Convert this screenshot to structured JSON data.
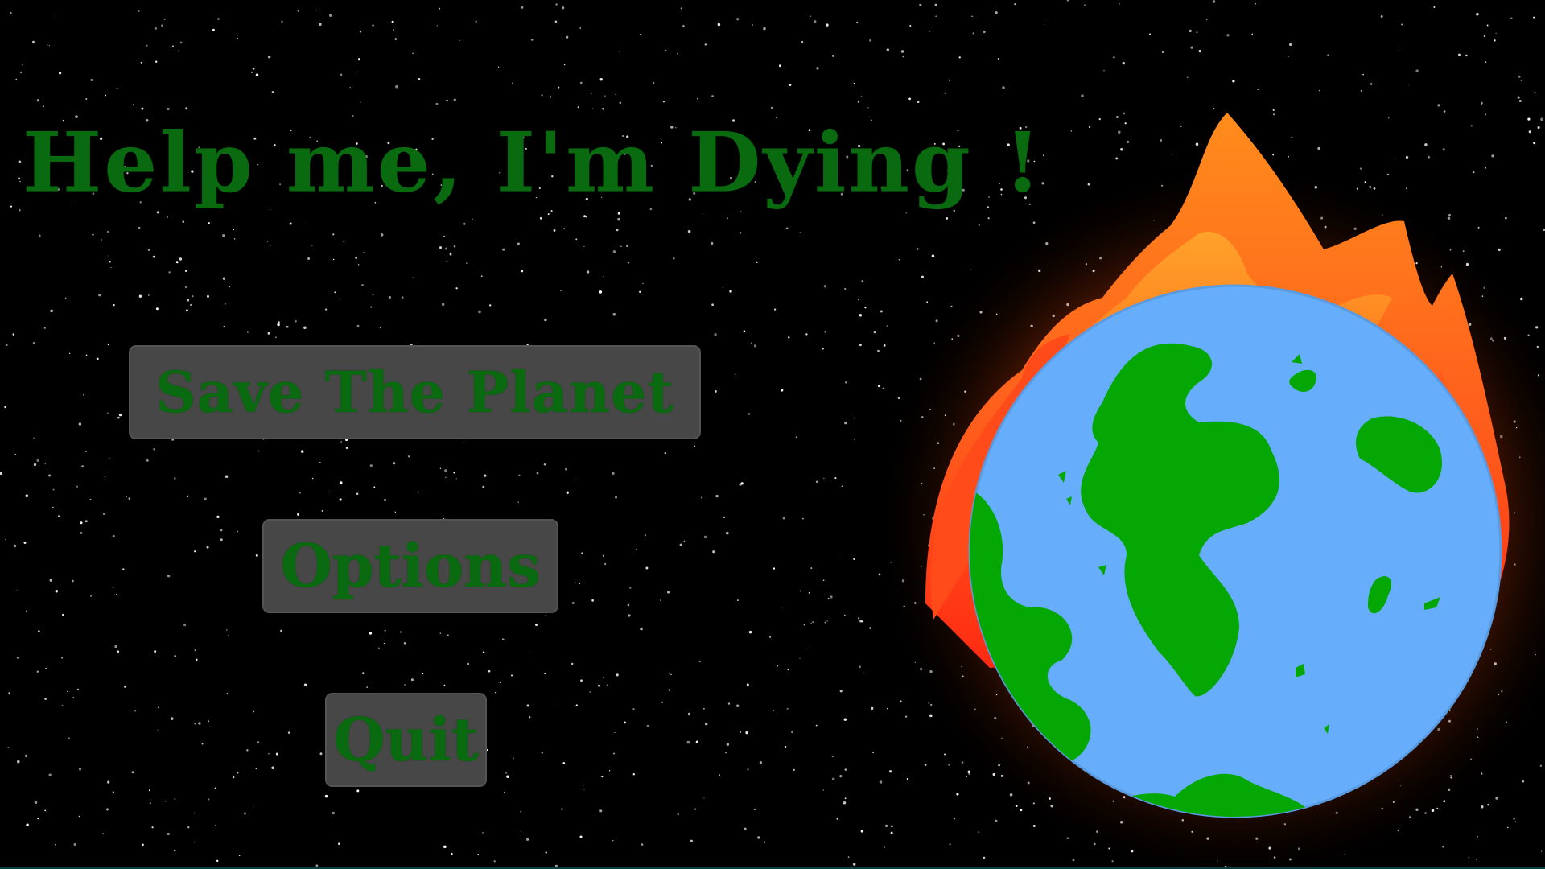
{
  "game": {
    "title": "Help me, I'm Dying !",
    "menu": {
      "save_label": "Save The Planet",
      "options_label": "Options",
      "quit_label": "Quit"
    }
  },
  "colors": {
    "background": "#000000",
    "text_green": "#0a6a10",
    "button_gray": "#474747",
    "ocean_blue": "#66aefc",
    "land_green": "#04a704",
    "flame_orange": "#ff8a1c",
    "flame_red": "#ff3e1c"
  },
  "icons": {
    "planet": "burning-earth-icon"
  }
}
